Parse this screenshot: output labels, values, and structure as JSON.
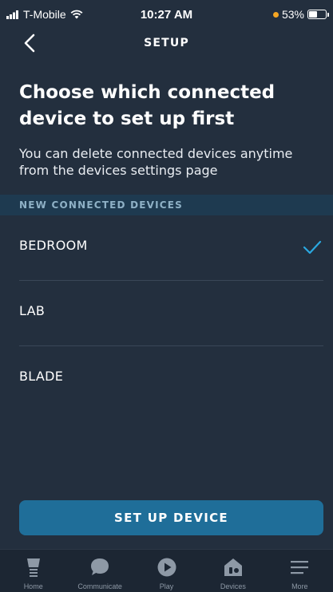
{
  "status_bar": {
    "carrier": "T-Mobile",
    "time": "10:27 AM",
    "battery": "53%",
    "battery_level": 0.53
  },
  "nav": {
    "title": "SETUP",
    "back_icon": "chevron-left-icon"
  },
  "heading": "Choose which connected device to set up first",
  "subtext": "You can delete connected devices anytime from the devices settings page",
  "section_header": "NEW CONNECTED DEVICES",
  "devices": [
    {
      "label": "BEDROOM",
      "selected": true
    },
    {
      "label": "LAB",
      "selected": false
    },
    {
      "label": "BLADE",
      "selected": false
    }
  ],
  "setup_button": "SET UP DEVICE",
  "tabs": [
    {
      "label": "Home",
      "icon": "home-icon"
    },
    {
      "label": "Communicate",
      "icon": "chat-bubble-icon"
    },
    {
      "label": "Play",
      "icon": "play-icon"
    },
    {
      "label": "Devices",
      "icon": "devices-icon"
    },
    {
      "label": "More",
      "icon": "menu-icon"
    }
  ],
  "colors": {
    "background": "#232f3e",
    "accent": "#1f6e99",
    "check": "#2aa8e0",
    "section_bg": "#1e3a50",
    "tab_icon": "#8e99a6"
  }
}
